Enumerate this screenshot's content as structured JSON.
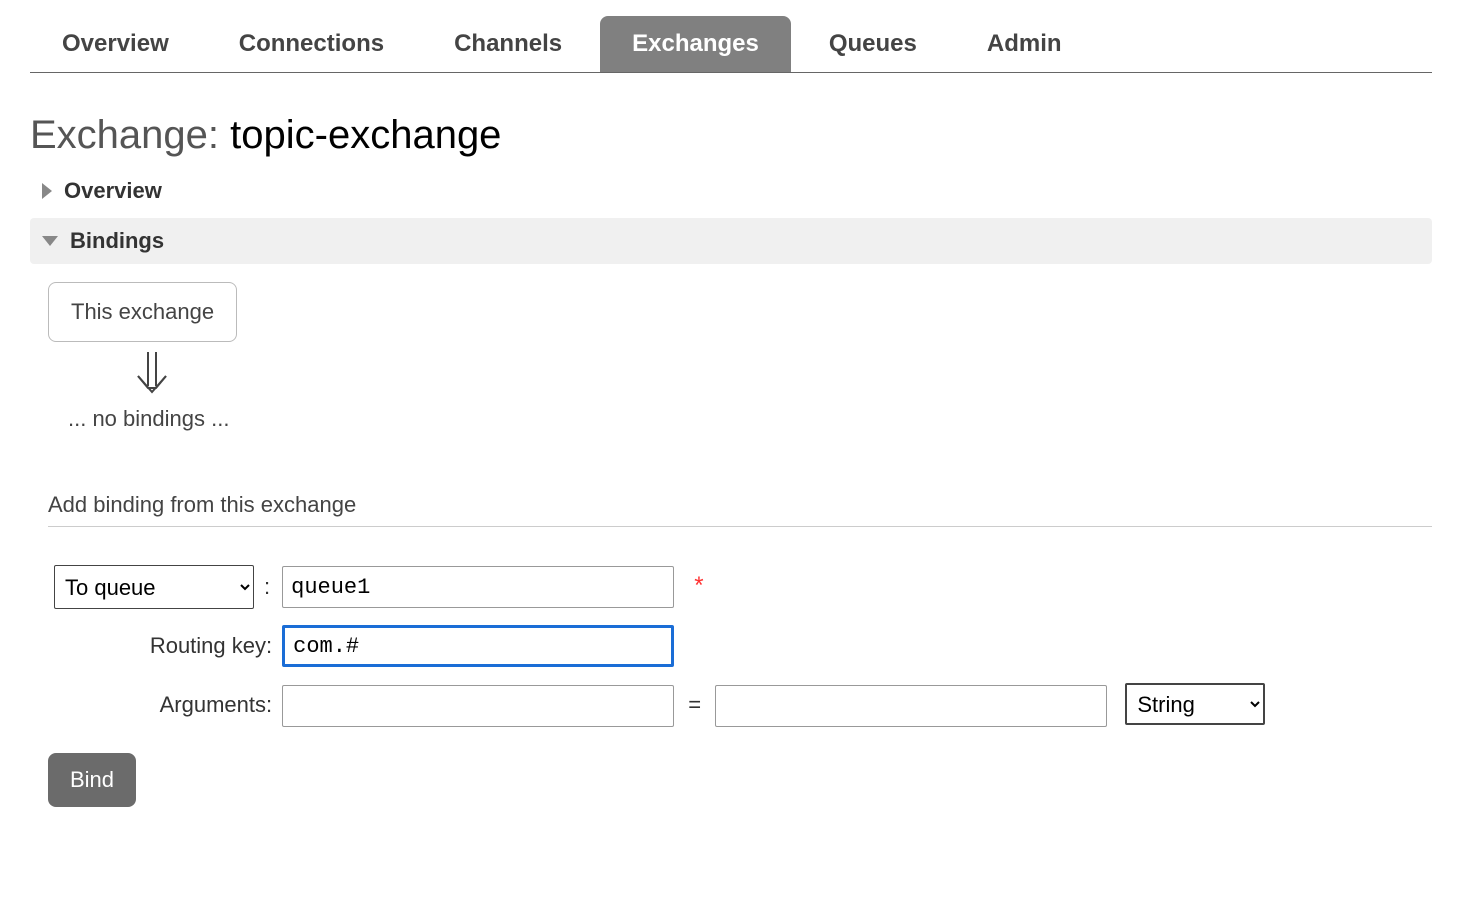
{
  "tabs": {
    "overview": "Overview",
    "connections": "Connections",
    "channels": "Channels",
    "exchanges": "Exchanges",
    "queues": "Queues",
    "admin": "Admin"
  },
  "page": {
    "title_prefix": "Exchange: ",
    "exchange_name": "topic-exchange"
  },
  "sections": {
    "overview_label": "Overview",
    "bindings_label": "Bindings"
  },
  "bindings": {
    "this_exchange_box": "This exchange",
    "no_bindings_text": "... no bindings ..."
  },
  "add_binding": {
    "subtitle": "Add binding from this exchange",
    "target_selected": "To queue",
    "colon": ":",
    "queue_value": "queue1",
    "required_mark": "*",
    "routing_key_label": "Routing key:",
    "routing_key_value": "com.#",
    "arguments_label": "Arguments:",
    "arg_key_value": "",
    "eq": "=",
    "arg_val_value": "",
    "type_selected": "String",
    "bind_button": "Bind"
  }
}
